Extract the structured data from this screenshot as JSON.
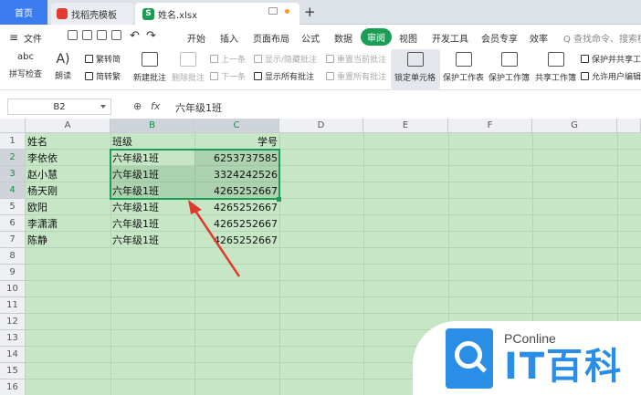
{
  "tabs": {
    "home": "首页",
    "template": "找稻壳模板",
    "file": "姓名.xlsx"
  },
  "menu": {
    "file": "文件",
    "items": [
      "开始",
      "插入",
      "页面布局",
      "公式",
      "数据",
      "审阅",
      "视图",
      "开发工具",
      "会员专享",
      "效率"
    ],
    "active": "审阅",
    "search_placeholder": "Q 查找命令、搜索模板"
  },
  "ribbon": {
    "spellcheck": "拼写检查",
    "read": "朗读",
    "trad_to_simp": "繁转简",
    "simp_to_trad": "简转繁",
    "new_comment": "新建批注",
    "delete_comment": "删除批注",
    "prev": "上一条",
    "next": "下一条",
    "show_hide_comment": "显示/隐藏批注",
    "show_all_comments": "显示所有批注",
    "reset_current": "重置当前批注",
    "reset_all": "重置所有批注",
    "lock_cell": "锁定单元格",
    "protect_sheet": "保护工作表",
    "protect_workbook": "保护工作簿",
    "share_workbook": "共享工作簿",
    "protect_share": "保护并共享工",
    "allow_edit": "允许用户编辑"
  },
  "formula_bar": {
    "name_box": "B2",
    "fx": "fx",
    "value": "六年级1班"
  },
  "columns": [
    "A",
    "B",
    "C",
    "D",
    "E",
    "F",
    "G"
  ],
  "rows": [
    "1",
    "2",
    "3",
    "4",
    "5",
    "6",
    "7",
    "8",
    "9",
    "10",
    "11",
    "12",
    "13",
    "14",
    "15",
    "16"
  ],
  "cells": [
    {
      "a": "姓名",
      "b": "班级",
      "c": "学号"
    },
    {
      "a": "李依依",
      "b": "六年级1班",
      "c": "6253737585"
    },
    {
      "a": "赵小慧",
      "b": "六年级1班",
      "c": "3324242526"
    },
    {
      "a": "杨天刚",
      "b": "六年级1班",
      "c": "4265252667"
    },
    {
      "a": "欧阳",
      "b": "六年级1班",
      "c": "4265252667"
    },
    {
      "a": "李潇潇",
      "b": "六年级1班",
      "c": "4265252667"
    },
    {
      "a": "陈静",
      "b": "六年级1班",
      "c": "4265252667"
    }
  ],
  "watermark": {
    "brand": "PConline",
    "name": "IT百科"
  },
  "colors": {
    "accent": "#1a9e55",
    "home_tab": "#3b7bf0",
    "sheet_bg": "#c6e6c6",
    "arrow": "#e03a2f"
  }
}
